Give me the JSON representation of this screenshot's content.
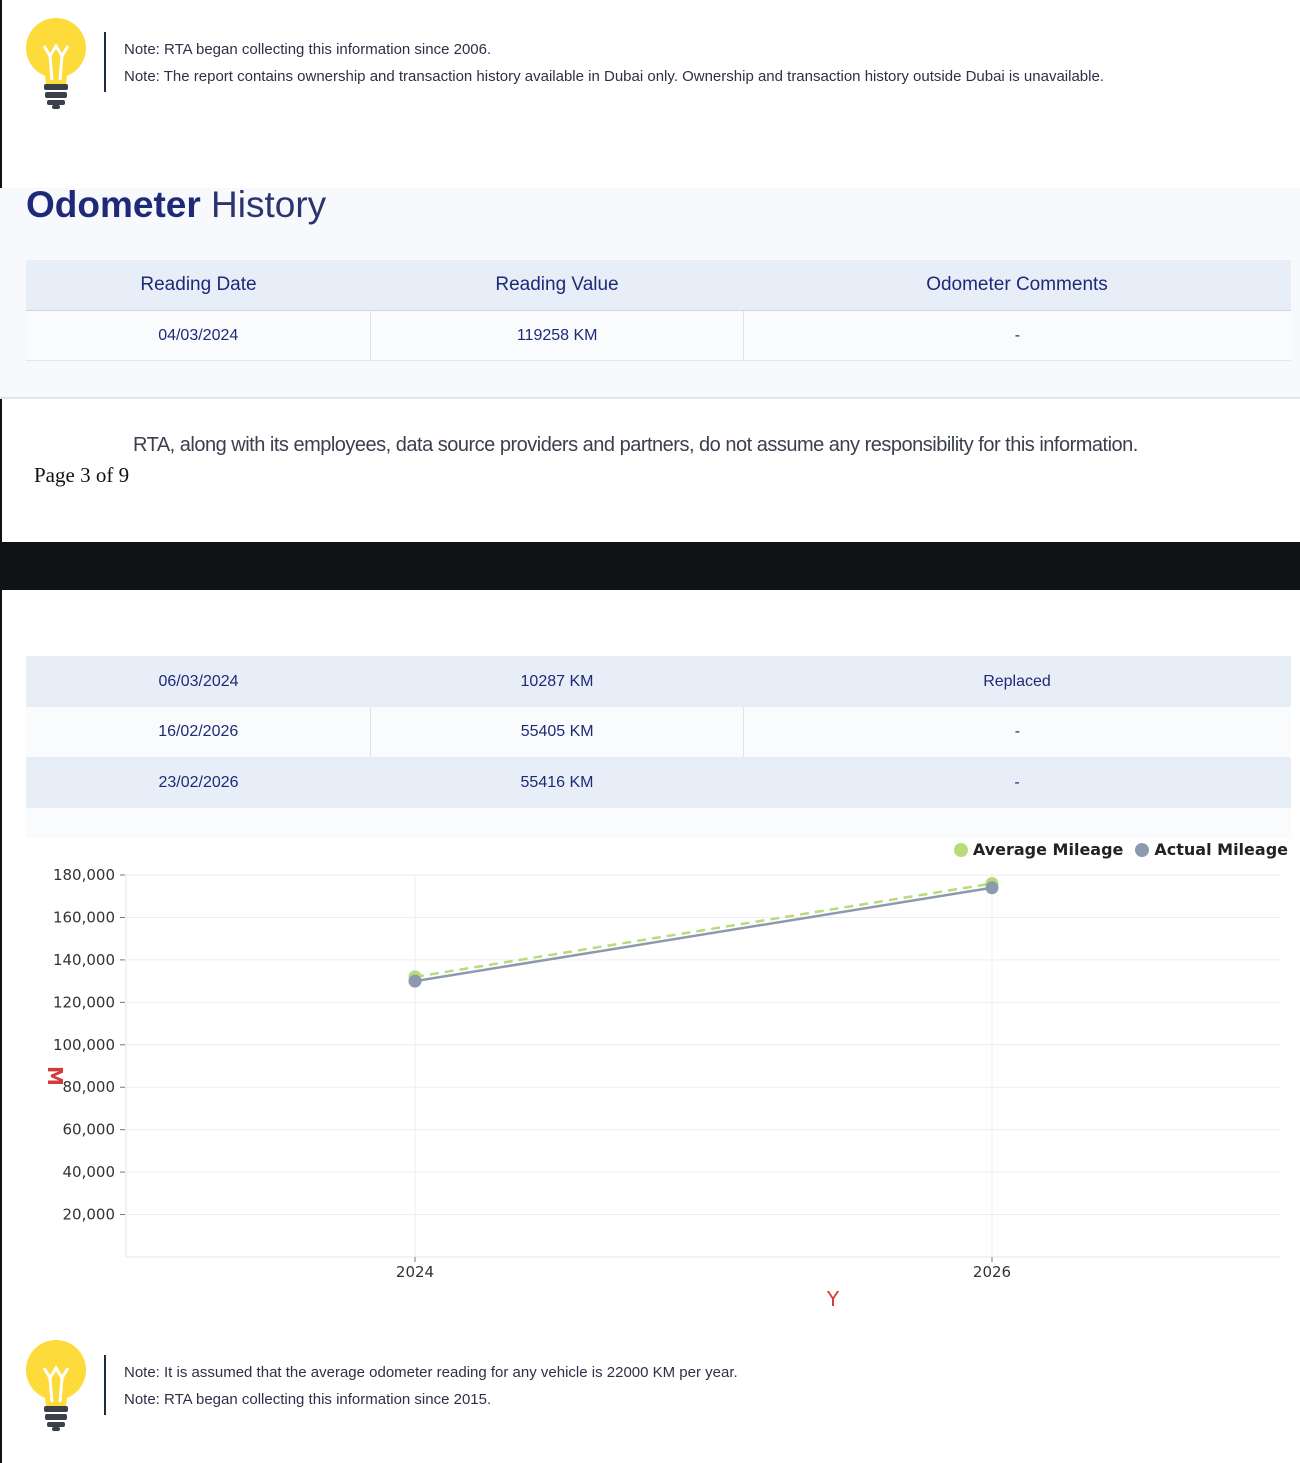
{
  "notes_top": [
    "Note: RTA began collecting this information since 2006.",
    "Note: The report contains ownership and transaction history available in Dubai only. Ownership and transaction history outside Dubai is unavailable."
  ],
  "section": {
    "title_bold": "Odometer",
    "title_light": "History"
  },
  "table": {
    "headers": [
      "Reading Date",
      "Reading Value",
      "Odometer Comments"
    ],
    "rows_page1": [
      {
        "date": "04/03/2024",
        "value": "119258 KM",
        "comment": "-"
      }
    ],
    "rows_page2": [
      {
        "date": "06/03/2024",
        "value": "10287 KM",
        "comment": "Replaced"
      },
      {
        "date": "16/02/2026",
        "value": "55405 KM",
        "comment": "-"
      },
      {
        "date": "23/02/2026",
        "value": "55416 KM",
        "comment": "-"
      }
    ]
  },
  "footer": {
    "disclaimer": "RTA, along with its employees, data source providers and partners, do not assume any responsibility for this information.",
    "page": "Page 3 of 9"
  },
  "chart_data": {
    "type": "line",
    "x": [
      2024,
      2026
    ],
    "series": [
      {
        "name": "Average Mileage",
        "values": [
          132000,
          176000
        ],
        "color": "#b7dd7a",
        "style": "dashed"
      },
      {
        "name": "Actual Mileage",
        "values": [
          130000,
          174000
        ],
        "color": "#8d9aae",
        "style": "solid"
      }
    ],
    "xlabel": "Y",
    "ylabel": "M",
    "yticks": [
      "20,000",
      "40,000",
      "60,000",
      "80,000",
      "100,000",
      "120,000",
      "140,000",
      "160,000",
      "180,000"
    ],
    "xticks": [
      "2024",
      "2026"
    ],
    "ylim": [
      0,
      180000
    ],
    "grid": true,
    "legend": "top-right"
  },
  "notes_bottom": [
    "Note: It is assumed that the average odometer reading for any vehicle is 22000 KM per year.",
    "Note: RTA began collecting this information since 2015."
  ],
  "colors": {
    "heading": "#1e2a78",
    "row_shade": "#e7eef7",
    "axis_label": "#d23b3b"
  },
  "icons": [
    "lightbulb-icon"
  ]
}
